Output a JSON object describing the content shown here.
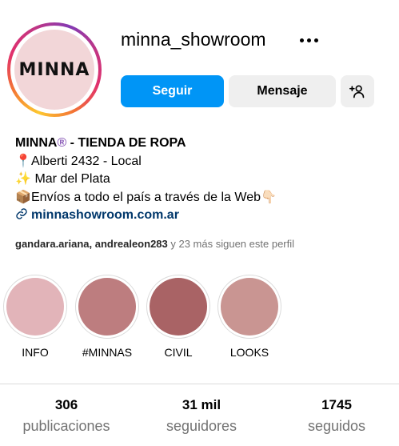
{
  "profile": {
    "avatar_text": "MINNA",
    "username": "minna_showroom",
    "follow_label": "Seguir",
    "message_label": "Mensaje"
  },
  "bio": {
    "name": "MINNA",
    "name_badge": "®",
    "name_suffix": " - TIENDA DE ROPA",
    "line1_emoji": "📍",
    "line1": "Alberti 2432 - Local",
    "line2_emoji": "✨",
    "line2": " Mar del Plata",
    "line3_emoji": "📦",
    "line3": "Envíos a todo el país a través de la Web",
    "line3_emoji_end": "👇🏻",
    "link": "minnashowroom.com.ar"
  },
  "followed_by": {
    "users": "gandara.ariana, andrealeon283",
    "rest": " y 23 más siguen este perfil"
  },
  "highlights": [
    {
      "label": "INFO",
      "color": "#e2b4b9"
    },
    {
      "label": "#MINNAS",
      "color": "#bd7d7f"
    },
    {
      "label": "CIVIL",
      "color": "#a96365"
    },
    {
      "label": "LOOKS",
      "color": "#c99592"
    }
  ],
  "stats": [
    {
      "value": "306",
      "label": "publicaciones"
    },
    {
      "value": "31 mil",
      "label": "seguidores"
    },
    {
      "value": "1745",
      "label": "seguidos"
    }
  ],
  "colors": {
    "accent": "#0095f6",
    "link": "#00376b",
    "secondary_button": "#efefef"
  }
}
